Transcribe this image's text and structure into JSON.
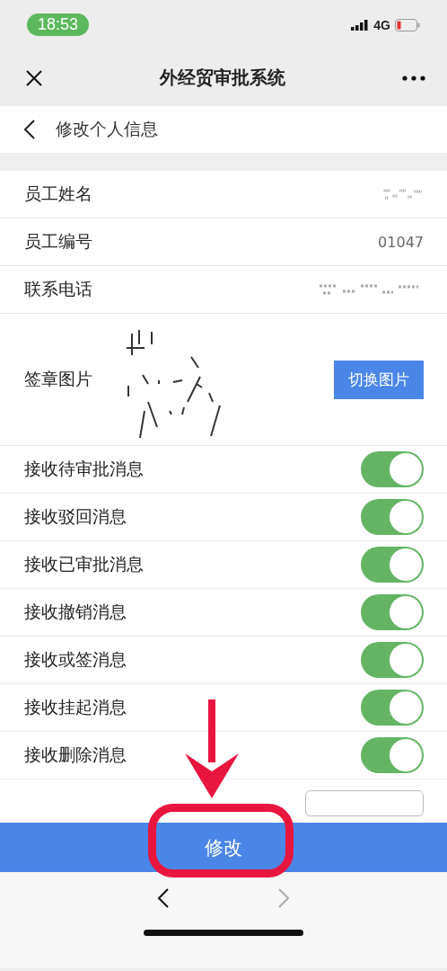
{
  "status_bar": {
    "time": "18:53",
    "network": "4G"
  },
  "nav": {
    "title": "外经贸审批系统"
  },
  "page": {
    "title": "修改个人信息"
  },
  "info_rows": [
    {
      "label": "员工姓名"
    },
    {
      "label": "员工编号",
      "value": "01047"
    },
    {
      "label": "联系电话"
    }
  ],
  "signature": {
    "label": "签章图片",
    "button": "切换图片"
  },
  "toggles": [
    {
      "label": "接收待审批消息",
      "on": true
    },
    {
      "label": "接收驳回消息",
      "on": true
    },
    {
      "label": "接收已审批消息",
      "on": true
    },
    {
      "label": "接收撤销消息",
      "on": true
    },
    {
      "label": "接收或签消息",
      "on": true
    },
    {
      "label": "接收挂起消息",
      "on": true
    },
    {
      "label": "接收删除消息",
      "on": true
    }
  ],
  "time_row": {
    "kind": "input"
  },
  "submit": "修改"
}
